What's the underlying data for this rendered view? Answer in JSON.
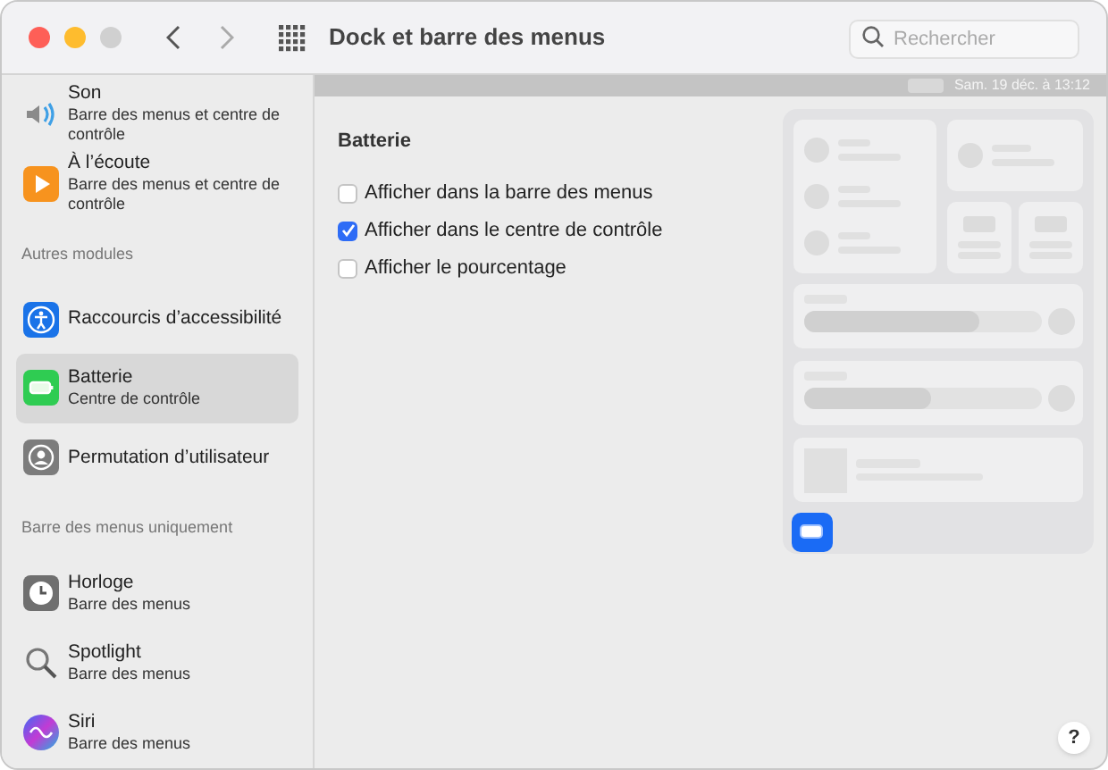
{
  "window": {
    "title": "Dock et barre des menus"
  },
  "search": {
    "placeholder": "Rechercher"
  },
  "sidebar": {
    "entries": [
      {
        "kind": "item",
        "title": "Son",
        "subtitle": "Barre des menus et centre de contrôle",
        "selected": false
      },
      {
        "kind": "item",
        "title": "À l’écoute",
        "subtitle": "Barre des menus et centre de contrôle",
        "selected": false
      },
      {
        "kind": "header",
        "title": "Autres modules"
      },
      {
        "kind": "item",
        "title": "Raccourcis d’accessibilité",
        "selected": false
      },
      {
        "kind": "item",
        "title": "Batterie",
        "subtitle": "Centre de contrôle",
        "selected": true
      },
      {
        "kind": "item",
        "title": "Permutation d’utilisateur",
        "selected": false
      },
      {
        "kind": "header",
        "title": "Barre des menus uniquement"
      },
      {
        "kind": "item",
        "title": "Horloge",
        "subtitle": "Barre des menus",
        "selected": false
      },
      {
        "kind": "item",
        "title": "Spotlight",
        "subtitle": "Barre des menus",
        "selected": false
      },
      {
        "kind": "item",
        "title": "Siri",
        "subtitle": "Barre des menus",
        "selected": false
      }
    ]
  },
  "menu_bar_preview": {
    "clock": "Sam. 19 déc. à 13:12"
  },
  "section": {
    "title": "Batterie",
    "options": [
      {
        "label": "Afficher dans la barre des menus",
        "checked": false
      },
      {
        "label": "Afficher dans le centre de contrôle",
        "checked": true
      },
      {
        "label": "Afficher le pourcentage",
        "checked": false
      }
    ]
  },
  "help_button": {
    "label": "?"
  }
}
